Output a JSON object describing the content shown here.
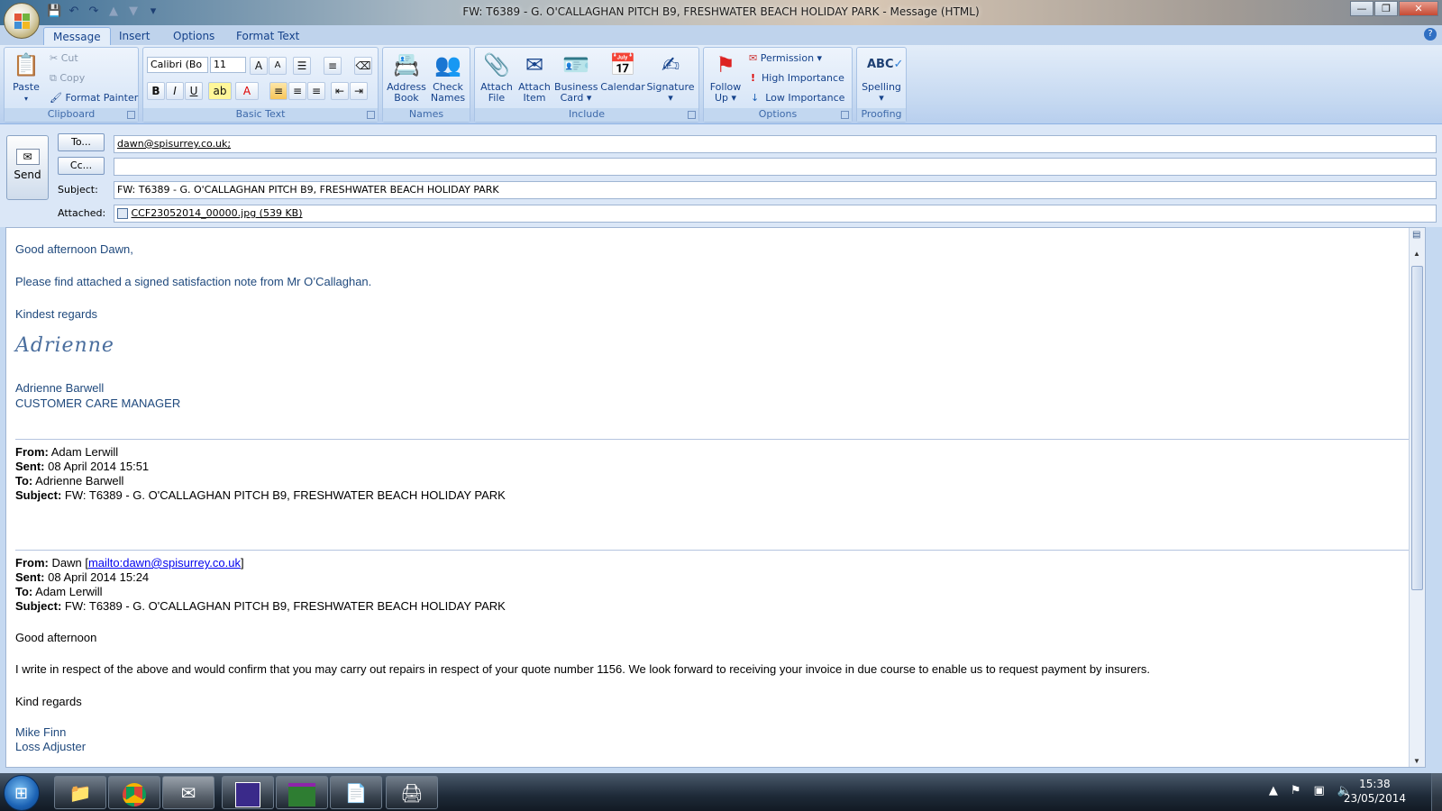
{
  "window": {
    "title": "FW: T6389 - G. O'CALLAGHAN PITCH B9, FRESHWATER BEACH HOLIDAY PARK - Message (HTML)",
    "controls": [
      "—",
      "❐",
      "✕"
    ]
  },
  "tabs": [
    {
      "label": "Message",
      "active": true
    },
    {
      "label": "Insert"
    },
    {
      "label": "Options"
    },
    {
      "label": "Format Text"
    }
  ],
  "ribbon": {
    "clipboard": {
      "label": "Clipboard",
      "paste": "Paste",
      "cut": "Cut",
      "copy": "Copy",
      "format_painter": "Format Painter"
    },
    "basic_text": {
      "label": "Basic Text",
      "font": "Calibri (Bo",
      "size": "11"
    },
    "names": {
      "label": "Names",
      "address_book": [
        "Address",
        "Book"
      ],
      "check_names": [
        "Check",
        "Names"
      ]
    },
    "include": {
      "label": "Include",
      "attach_file": [
        "Attach",
        "File"
      ],
      "attach_item": [
        "Attach",
        "Item"
      ],
      "business_card": [
        "Business",
        "Card"
      ],
      "calendar": "Calendar",
      "signature": "Signature"
    },
    "options": {
      "label": "Options",
      "follow_up": [
        "Follow",
        "Up"
      ],
      "permission": "Permission",
      "high_importance": "High Importance",
      "low_importance": "Low Importance"
    },
    "proofing": {
      "label": "Proofing",
      "spelling": "Spelling",
      "spelling_icon_text": "ABC"
    }
  },
  "header": {
    "send_label": "Send",
    "to_button": "To...",
    "cc_button": "Cc...",
    "subject_label": "Subject:",
    "attached_label": "Attached:",
    "to_value": "dawn@spisurrey.co.uk;",
    "cc_value": "",
    "subject_value": "FW: T6389 - G. O'CALLAGHAN PITCH B9, FRESHWATER BEACH HOLIDAY PARK",
    "attachment": "CCF23052014_00000.jpg (539 KB)"
  },
  "body": {
    "greeting": "Good afternoon Dawn,",
    "line1": "Please find attached a signed satisfaction note from Mr O’Callaghan.",
    "closing": "Kindest regards",
    "signature_script": "Adrienne",
    "sig_name": "Adrienne Barwell",
    "sig_title": "CUSTOMER CARE MANAGER",
    "fw1": {
      "from_label": "From:",
      "from": "Adam Lerwill",
      "sent_label": "Sent:",
      "sent": "08 April 2014 15:51",
      "to_label": "To:",
      "to": "Adrienne Barwell",
      "subject_label": "Subject:",
      "subject": "FW: T6389 - G. O'CALLAGHAN PITCH B9, FRESHWATER BEACH HOLIDAY PARK"
    },
    "fw2": {
      "from_label": "From:",
      "from": "Dawn [",
      "from_link": "mailto:dawn@spisurrey.co.uk",
      "from_end": "]",
      "sent_label": "Sent:",
      "sent": "08 April 2014 15:24",
      "to_label": "To:",
      "to": "Adam Lerwill",
      "subject_label": "Subject:",
      "subject": "FW: T6389 - G. O'CALLAGHAN PITCH B9, FRESHWATER BEACH HOLIDAY PARK"
    },
    "fw2_greeting": "Good afternoon",
    "fw2_text": "I write in respect of the above and would confirm that you may carry out repairs in respect of your quote number 1156.   We look forward to receiving your invoice in due course to enable us to request payment by insurers.",
    "fw2_closing": "Kind regards",
    "fw2_name": "Mike Finn",
    "fw2_title": "Loss Adjuster"
  },
  "taskbar": {
    "time": "15:38",
    "date": "23/05/2014"
  }
}
